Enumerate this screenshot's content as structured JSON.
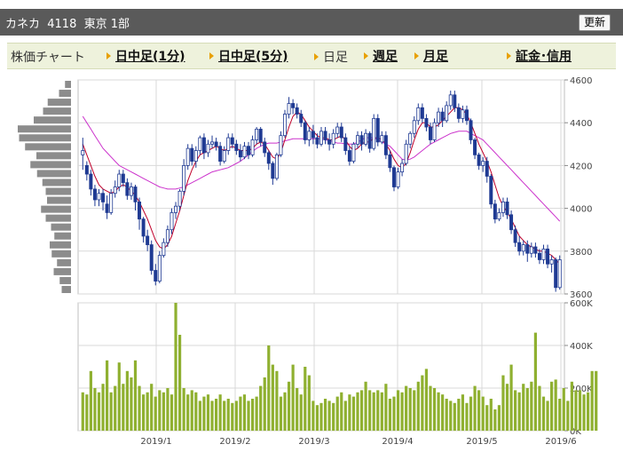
{
  "header": {
    "title": "カネカ  4118  東京 1部",
    "refresh_label": "更新"
  },
  "nav": {
    "chart_label": "株価チャート",
    "links": [
      {
        "label": "日中足(1分)",
        "link": true
      },
      {
        "label": "日中足(5分)",
        "link": true
      },
      {
        "label": "日足",
        "link": false
      },
      {
        "label": "週足",
        "link": true
      },
      {
        "label": "月足",
        "link": true
      },
      {
        "label": "証金･信用",
        "link": true
      }
    ]
  },
  "colors": {
    "up": "#ffffff",
    "down": "#1f3a93",
    "candle_edge": "#1f3a93",
    "ma_short": "#c0002a",
    "ma_long": "#cc33cc",
    "volume": "#8fb030",
    "volume_profile": "#8c8c8c"
  },
  "chart_data": [
    {
      "type": "candlestick",
      "title": "",
      "ylim": [
        3600,
        4600
      ],
      "yticks": [
        3600,
        3800,
        4000,
        4200,
        4400,
        4600
      ],
      "xticks": [
        "2019/1",
        "2019/2",
        "2019/3",
        "2019/4",
        "2019/5",
        "2019/6"
      ],
      "grid": true,
      "candles": [
        [
          4250,
          4270,
          4330,
          4180
        ],
        [
          4200,
          4160,
          4220,
          4130
        ],
        [
          4160,
          4090,
          4180,
          4060
        ],
        [
          4090,
          4040,
          4110,
          4010
        ],
        [
          4040,
          4070,
          4090,
          4010
        ],
        [
          4070,
          4030,
          4090,
          3990
        ],
        [
          4020,
          3980,
          4060,
          3950
        ],
        [
          3980,
          4070,
          4090,
          3970
        ],
        [
          4070,
          4100,
          4130,
          4050
        ],
        [
          4100,
          4160,
          4180,
          4080
        ],
        [
          4160,
          4120,
          4180,
          4100
        ],
        [
          4120,
          4060,
          4140,
          4040
        ],
        [
          4060,
          4100,
          4120,
          4040
        ],
        [
          4100,
          4030,
          4110,
          3990
        ],
        [
          4030,
          3950,
          4050,
          3900
        ],
        [
          3950,
          3870,
          3960,
          3840
        ],
        [
          3870,
          3830,
          3900,
          3800
        ],
        [
          3830,
          3710,
          3850,
          3690
        ],
        [
          3710,
          3660,
          3740,
          3640
        ],
        [
          3660,
          3780,
          3800,
          3650
        ],
        [
          3780,
          3840,
          3860,
          3770
        ],
        [
          3840,
          3900,
          3920,
          3820
        ],
        [
          3900,
          3980,
          4000,
          3880
        ],
        [
          3980,
          4010,
          4030,
          3950
        ],
        [
          4010,
          4080,
          4090,
          3990
        ],
        [
          4080,
          4200,
          4230,
          4060
        ],
        [
          4200,
          4280,
          4300,
          4180
        ],
        [
          4280,
          4220,
          4300,
          4200
        ],
        [
          4220,
          4270,
          4290,
          4190
        ],
        [
          4270,
          4330,
          4340,
          4250
        ],
        [
          4330,
          4260,
          4350,
          4230
        ],
        [
          4260,
          4300,
          4320,
          4240
        ],
        [
          4300,
          4310,
          4340,
          4280
        ],
        [
          4310,
          4290,
          4330,
          4270
        ],
        [
          4290,
          4220,
          4310,
          4200
        ],
        [
          4220,
          4270,
          4290,
          4210
        ],
        [
          4270,
          4330,
          4350,
          4250
        ],
        [
          4330,
          4300,
          4350,
          4280
        ],
        [
          4300,
          4270,
          4320,
          4250
        ],
        [
          4270,
          4240,
          4300,
          4220
        ],
        [
          4240,
          4290,
          4310,
          4230
        ],
        [
          4290,
          4250,
          4310,
          4230
        ],
        [
          4250,
          4320,
          4340,
          4240
        ],
        [
          4320,
          4370,
          4380,
          4300
        ],
        [
          4370,
          4310,
          4380,
          4290
        ],
        [
          4310,
          4260,
          4330,
          4240
        ],
        [
          4260,
          4210,
          4270,
          4180
        ],
        [
          4210,
          4140,
          4220,
          4110
        ],
        [
          4140,
          4250,
          4260,
          4130
        ],
        [
          4250,
          4340,
          4360,
          4240
        ],
        [
          4340,
          4440,
          4460,
          4330
        ],
        [
          4440,
          4490,
          4520,
          4420
        ],
        [
          4490,
          4470,
          4510,
          4440
        ],
        [
          4470,
          4440,
          4490,
          4420
        ],
        [
          4440,
          4400,
          4460,
          4380
        ],
        [
          4400,
          4320,
          4410,
          4300
        ],
        [
          4320,
          4360,
          4380,
          4290
        ],
        [
          4360,
          4330,
          4390,
          4300
        ],
        [
          4330,
          4300,
          4350,
          4280
        ],
        [
          4300,
          4360,
          4380,
          4290
        ],
        [
          4360,
          4320,
          4380,
          4300
        ],
        [
          4320,
          4300,
          4350,
          4270
        ],
        [
          4300,
          4350,
          4370,
          4280
        ],
        [
          4350,
          4380,
          4400,
          4330
        ],
        [
          4380,
          4330,
          4400,
          4310
        ],
        [
          4330,
          4270,
          4350,
          4250
        ],
        [
          4270,
          4220,
          4290,
          4200
        ],
        [
          4220,
          4300,
          4310,
          4210
        ],
        [
          4300,
          4340,
          4360,
          4280
        ],
        [
          4340,
          4300,
          4360,
          4270
        ],
        [
          4300,
          4350,
          4370,
          4290
        ],
        [
          4350,
          4280,
          4360,
          4260
        ],
        [
          4280,
          4420,
          4440,
          4270
        ],
        [
          4420,
          4310,
          4440,
          4290
        ],
        [
          4310,
          4340,
          4360,
          4300
        ],
        [
          4340,
          4250,
          4360,
          4230
        ],
        [
          4250,
          4190,
          4270,
          4170
        ],
        [
          4190,
          4100,
          4200,
          4080
        ],
        [
          4100,
          4170,
          4190,
          4090
        ],
        [
          4170,
          4210,
          4230,
          4150
        ],
        [
          4210,
          4300,
          4320,
          4200
        ],
        [
          4300,
          4350,
          4360,
          4280
        ],
        [
          4350,
          4410,
          4430,
          4330
        ],
        [
          4410,
          4470,
          4490,
          4390
        ],
        [
          4470,
          4420,
          4490,
          4400
        ],
        [
          4420,
          4380,
          4440,
          4360
        ],
        [
          4380,
          4320,
          4400,
          4300
        ],
        [
          4320,
          4400,
          4420,
          4310
        ],
        [
          4400,
          4450,
          4470,
          4380
        ],
        [
          4450,
          4410,
          4470,
          4380
        ],
        [
          4410,
          4480,
          4500,
          4400
        ],
        [
          4480,
          4530,
          4550,
          4460
        ],
        [
          4530,
          4470,
          4550,
          4450
        ],
        [
          4470,
          4420,
          4490,
          4400
        ],
        [
          4420,
          4460,
          4480,
          4400
        ],
        [
          4460,
          4410,
          4480,
          4390
        ],
        [
          4410,
          4320,
          4420,
          4300
        ],
        [
          4320,
          4250,
          4330,
          4230
        ],
        [
          4250,
          4200,
          4260,
          4180
        ],
        [
          4200,
          4220,
          4240,
          4170
        ],
        [
          4220,
          4150,
          4240,
          4120
        ],
        [
          4150,
          4020,
          4160,
          4000
        ],
        [
          4020,
          3950,
          4040,
          3930
        ],
        [
          3950,
          3980,
          4000,
          3940
        ],
        [
          3980,
          4030,
          4050,
          3960
        ],
        [
          4030,
          3970,
          4050,
          3950
        ],
        [
          3970,
          3900,
          3990,
          3880
        ],
        [
          3900,
          3840,
          3920,
          3820
        ],
        [
          3840,
          3800,
          3870,
          3780
        ],
        [
          3800,
          3830,
          3850,
          3780
        ],
        [
          3830,
          3790,
          3850,
          3750
        ],
        [
          3790,
          3820,
          3840,
          3770
        ],
        [
          3820,
          3790,
          3840,
          3770
        ],
        [
          3790,
          3760,
          3810,
          3740
        ],
        [
          3760,
          3810,
          3830,
          3740
        ],
        [
          3810,
          3740,
          3830,
          3720
        ],
        [
          3740,
          3760,
          3780,
          3700
        ],
        [
          3760,
          3630,
          3770,
          3610
        ],
        [
          3630,
          3760,
          3780,
          3620
        ]
      ],
      "ma_short": [
        4300,
        4250,
        4200,
        4150,
        4110,
        4090,
        4080,
        4070,
        4080,
        4100,
        4110,
        4100,
        4080,
        4060,
        4030,
        3990,
        3950,
        3900,
        3850,
        3820,
        3810,
        3830,
        3870,
        3930,
        3990,
        4060,
        4130,
        4180,
        4220,
        4250,
        4260,
        4270,
        4280,
        4290,
        4280,
        4270,
        4280,
        4290,
        4280,
        4270,
        4270,
        4270,
        4280,
        4300,
        4310,
        4300,
        4270,
        4240,
        4230,
        4260,
        4320,
        4380,
        4430,
        4450,
        4440,
        4410,
        4380,
        4360,
        4340,
        4330,
        4330,
        4320,
        4320,
        4330,
        4340,
        4320,
        4290,
        4270,
        4280,
        4300,
        4310,
        4310,
        4330,
        4330,
        4320,
        4300,
        4270,
        4230,
        4200,
        4190,
        4210,
        4260,
        4320,
        4370,
        4400,
        4400,
        4380,
        4380,
        4390,
        4410,
        4430,
        4450,
        4470,
        4470,
        4460,
        4440,
        4400,
        4350,
        4300,
        4260,
        4220,
        4170,
        4110,
        4050,
        4010,
        3980,
        3950,
        3910,
        3870,
        3850,
        3830,
        3820,
        3810,
        3800,
        3800,
        3790,
        3780,
        3760,
        3740
      ],
      "ma_long": [
        4430,
        4400,
        4370,
        4340,
        4310,
        4280,
        4260,
        4240,
        4220,
        4200,
        4190,
        4180,
        4170,
        4160,
        4150,
        4140,
        4130,
        4120,
        4110,
        4100,
        4095,
        4090,
        4090,
        4090,
        4095,
        4100,
        4110,
        4120,
        4130,
        4140,
        4150,
        4160,
        4170,
        4175,
        4180,
        4185,
        4190,
        4200,
        4210,
        4220,
        4235,
        4250,
        4265,
        4280,
        4290,
        4300,
        4305,
        4305,
        4305,
        4310,
        4315,
        4320,
        4325,
        4325,
        4325,
        4325,
        4325,
        4325,
        4325,
        4325,
        4320,
        4315,
        4310,
        4305,
        4305,
        4300,
        4300,
        4300,
        4310,
        4320,
        4330,
        4330,
        4330,
        4320,
        4310,
        4300,
        4290,
        4270,
        4250,
        4230,
        4225,
        4230,
        4240,
        4255,
        4270,
        4285,
        4300,
        4310,
        4320,
        4330,
        4340,
        4350,
        4355,
        4360,
        4360,
        4360,
        4350,
        4340,
        4330,
        4320,
        4300,
        4280,
        4260,
        4240,
        4220,
        4200,
        4180,
        4160,
        4140,
        4120,
        4100,
        4080,
        4060,
        4040,
        4020,
        4000,
        3980,
        3960,
        3940
      ],
      "volume_profile": [
        90,
        180,
        350,
        420,
        560,
        800,
        780,
        690,
        520,
        610,
        510,
        430,
        380,
        360,
        450,
        380,
        300,
        250,
        320,
        290,
        210,
        260,
        170,
        140
      ]
    },
    {
      "type": "bar",
      "title": "",
      "ylim": [
        0,
        600
      ],
      "unit": "K",
      "yticks": [
        "0K",
        "200K",
        "400K",
        "600K"
      ],
      "values": [
        180,
        170,
        280,
        200,
        180,
        220,
        330,
        180,
        210,
        320,
        220,
        280,
        250,
        330,
        210,
        170,
        180,
        220,
        160,
        190,
        180,
        200,
        170,
        600,
        450,
        200,
        170,
        190,
        180,
        140,
        160,
        170,
        140,
        150,
        170,
        140,
        150,
        130,
        140,
        160,
        170,
        140,
        150,
        160,
        210,
        250,
        400,
        310,
        280,
        160,
        180,
        230,
        310,
        200,
        170,
        300,
        260,
        140,
        120,
        130,
        150,
        140,
        130,
        160,
        180,
        140,
        170,
        160,
        180,
        190,
        230,
        190,
        180,
        190,
        180,
        220,
        150,
        160,
        190,
        180,
        210,
        200,
        190,
        230,
        260,
        290,
        210,
        200,
        180,
        170,
        150,
        140,
        130,
        150,
        170,
        130,
        160,
        210,
        190,
        160,
        120,
        150,
        100,
        120,
        260,
        220,
        310,
        190,
        180,
        220,
        200,
        230,
        460,
        210,
        160,
        140,
        230,
        240,
        150,
        200,
        140,
        230,
        190,
        190,
        170,
        180,
        280,
        280
      ]
    }
  ]
}
